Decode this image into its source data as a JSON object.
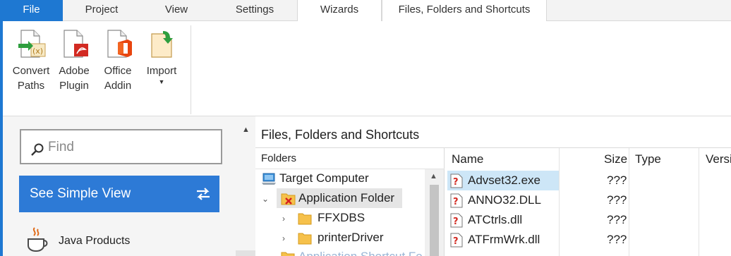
{
  "ribbon_tabs": [
    {
      "label": "File"
    },
    {
      "label": "Project"
    },
    {
      "label": "View"
    },
    {
      "label": "Settings"
    },
    {
      "label": "Wizards"
    },
    {
      "label": "Files, Folders and Shortcuts"
    }
  ],
  "active_tab": "Wizards",
  "ribbon_buttons": [
    {
      "line1": "Convert",
      "line2": "Paths",
      "icon": "convert-paths-icon"
    },
    {
      "line1": "Adobe",
      "line2": "Plugin",
      "icon": "adobe-pdf-icon"
    },
    {
      "line1": "Office",
      "line2": "Addin",
      "icon": "office-icon"
    },
    {
      "line1": "Import",
      "line2": "",
      "icon": "import-icon"
    }
  ],
  "left_pane": {
    "search_placeholder": "Find",
    "simple_view_label": "See Simple View",
    "java_products_label": "Java Products"
  },
  "right_pane": {
    "title": "Files, Folders and Shortcuts",
    "folders_header": "Folders",
    "tree": [
      {
        "label": "Target Computer",
        "icon": "computer-icon"
      },
      {
        "label": "Application Folder",
        "icon": "folder-error-icon",
        "selected": true
      },
      {
        "label": "FFXDBS",
        "icon": "folder-icon"
      },
      {
        "label": "printerDriver",
        "icon": "folder-icon"
      },
      {
        "label": "Application Shortcut Fo",
        "icon": "folder-icon"
      }
    ],
    "file_columns": [
      "Name",
      "Size",
      "Type",
      "Versi"
    ],
    "files": [
      {
        "name": "Advset32.exe",
        "size": "???",
        "selected": true
      },
      {
        "name": "ANNO32.DLL",
        "size": "???"
      },
      {
        "name": "ATCtrls.dll",
        "size": "???"
      },
      {
        "name": "ATFrmWrk.dll",
        "size": "???"
      }
    ]
  },
  "colors": {
    "accent": "#1e78d2",
    "simple_view_bg": "#2d7ad6",
    "selection": "#cde6f7"
  }
}
